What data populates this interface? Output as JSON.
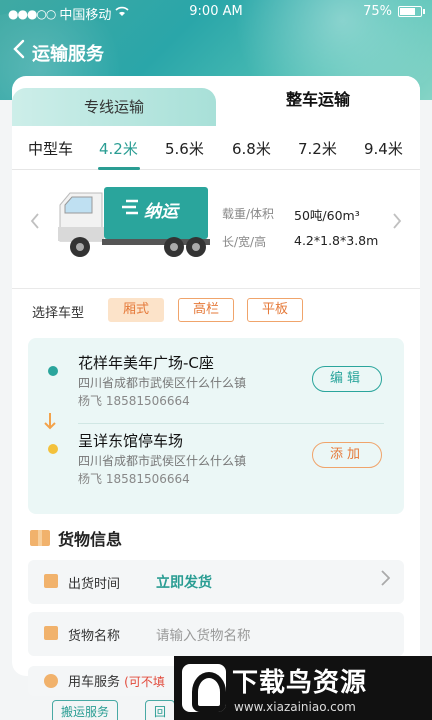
{
  "status_bar": {
    "carrier": "中国移动",
    "time": "9:00 AM",
    "battery": "75%"
  },
  "nav": {
    "title": "运输服务",
    "back_icon": "chevron-left-icon"
  },
  "tabs": [
    {
      "label": "专线运输",
      "active": false
    },
    {
      "label": "整车运输",
      "active": true
    }
  ],
  "vehicle_sizes": [
    {
      "label": "中型车",
      "active": false
    },
    {
      "label": "4.2米",
      "active": true
    },
    {
      "label": "5.6米",
      "active": false
    },
    {
      "label": "6.8米",
      "active": false
    },
    {
      "label": "7.2米",
      "active": false
    },
    {
      "label": "9.4米",
      "active": false
    }
  ],
  "truck": {
    "brand_text": "纳运",
    "specs": [
      {
        "label": "载重/体积",
        "value": "50吨/60m³"
      },
      {
        "label": "长/宽/高",
        "value": "4.2*1.8*3.8m"
      }
    ]
  },
  "vehicle_type": {
    "label": "选择车型",
    "options": [
      {
        "label": "厢式",
        "active": true
      },
      {
        "label": "高栏",
        "active": false
      },
      {
        "label": "平板",
        "active": false
      }
    ]
  },
  "route": {
    "from": {
      "place": "花样年美年广场-C座",
      "address": "四川省成都市武侯区什么什么镇",
      "contact": "杨飞  18581506664",
      "button": "编辑",
      "color": "#2aa59c"
    },
    "to": {
      "place": "呈详东馆停车场",
      "address": "四川省成都市武侯区什么什么镇",
      "contact": "杨飞  18581506664",
      "button": "添加",
      "color": "#f3c13b"
    }
  },
  "cargo": {
    "title": "货物信息",
    "ship_time": {
      "label": "出货时间",
      "value": "立即发货"
    },
    "name": {
      "label": "货物名称",
      "placeholder": "请输入货物名称"
    },
    "service": {
      "label": "用车服务",
      "note": "(可不填",
      "options": [
        "搬运服务",
        "回"
      ]
    }
  },
  "watermark": {
    "title": "下载鸟资源",
    "url": "www.xiazainiao.com"
  },
  "colors": {
    "accent": "#2a9d93",
    "orange": "#e57a3a"
  }
}
